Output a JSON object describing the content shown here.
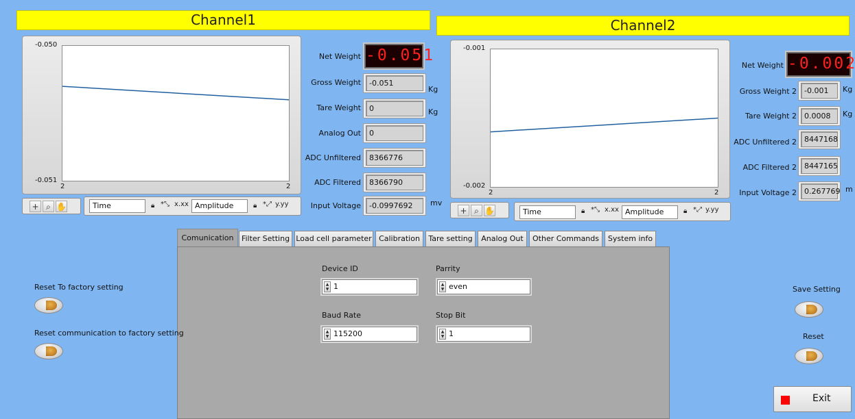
{
  "channel1": {
    "title": "Channel1",
    "graph": {
      "y_top": "-0.050",
      "y_bottom": "-0.051",
      "x_left": "2",
      "x_right": "2",
      "line_start": -0.0503,
      "line_end": -0.0504,
      "x_axis_field": "Time",
      "y_axis_field": "Amplitude"
    },
    "net_weight_label": "Net Weight",
    "net_weight_value": "-0.051",
    "gross_weight_label": "Gross Weight",
    "gross_weight_value": "-0.051",
    "gross_weight_unit": "Kg",
    "tare_weight_label": "Tare Weight",
    "tare_weight_value": "0",
    "tare_weight_unit": "Kg",
    "analog_out_label": "Analog Out",
    "analog_out_value": "0",
    "adc_unfiltered_label": "ADC Unfiltered",
    "adc_unfiltered_value": "8366776",
    "adc_filtered_label": "ADC Filtered",
    "adc_filtered_value": "8366790",
    "input_voltage_label": "Input Voltage",
    "input_voltage_value": "-0.0997692",
    "input_voltage_unit": "mv"
  },
  "channel2": {
    "title": "Channel2",
    "graph": {
      "y_top": "-0.001",
      "y_bottom": "-0.002",
      "x_left": "2",
      "x_right": "2",
      "line_start": -0.0016,
      "line_end": -0.0015,
      "x_axis_field": "Time",
      "y_axis_field": "Amplitude"
    },
    "net_weight_label": "Net Weight",
    "net_weight_value": "-0.002",
    "gross_weight_label": "Gross Weight 2",
    "gross_weight_value": "-0.001",
    "gross_weight_unit": "Kg",
    "tare_weight_label": "Tare  Weight 2",
    "tare_weight_value": "0.0008",
    "tare_weight_unit": "Kg",
    "adc_unfiltered_label": "ADC  Unfiltered 2",
    "adc_unfiltered_value": "8447168",
    "adc_filtered_label": "ADC Filtered 2",
    "adc_filtered_value": "8447165",
    "input_voltage_label": "Input Voltage 2",
    "input_voltage_value": "0.267769",
    "input_voltage_unit": "m"
  },
  "tabs": [
    {
      "label": "Comunication",
      "active": true
    },
    {
      "label": "Filter Setting"
    },
    {
      "label": "Load cell parameter"
    },
    {
      "label": "Calibration"
    },
    {
      "label": "Tare setting"
    },
    {
      "label": "Analog Out"
    },
    {
      "label": "Other Commands"
    },
    {
      "label": "System info"
    }
  ],
  "communication": {
    "device_id_label": "Device ID",
    "device_id_value": "1",
    "parity_label": "Parrity",
    "parity_value": "even",
    "baud_rate_label": "Baud Rate",
    "baud_rate_value": "115200",
    "stop_bit_label": "Stop Bit",
    "stop_bit_value": "1"
  },
  "left_actions": {
    "reset_factory_label": "Reset To factory setting",
    "reset_comm_label": "Reset communication to factory setting"
  },
  "right_actions": {
    "save_setting_label": "Save Setting",
    "reset_label": "Reset",
    "exit_label": "Exit"
  },
  "colors": {
    "background": "#7FB6F2",
    "header": "#FFFF00",
    "plot_line": "#1F5FA0",
    "led_text": "#FF2020",
    "exit_square": "#FF0000"
  },
  "icons": {
    "graph_tools": [
      "crosshair-icon",
      "zoom-icon",
      "pan-hand-icon"
    ],
    "axis_tools": [
      "lock-icon",
      "autoscale-icon",
      "format-icon"
    ]
  }
}
